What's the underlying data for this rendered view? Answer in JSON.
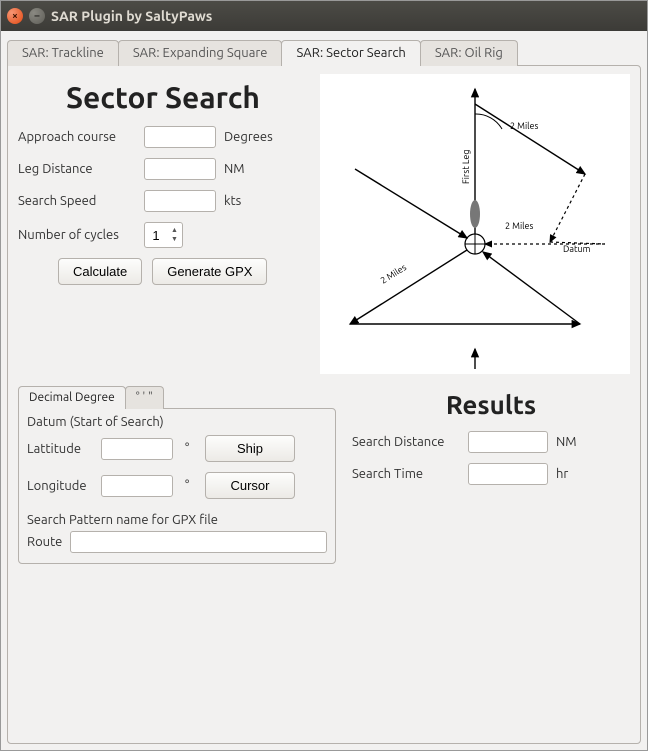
{
  "window_title": "SAR Plugin by SaltyPaws",
  "tabs": [
    {
      "label": "SAR: Trackline",
      "active": false
    },
    {
      "label": "SAR: Expanding Square",
      "active": false
    },
    {
      "label": "SAR: Sector Search",
      "active": true
    },
    {
      "label": "SAR: Oil Rig",
      "active": false
    }
  ],
  "sector": {
    "heading": "Sector Search",
    "approach_label": "Approach course",
    "approach_value": "",
    "approach_unit": "Degrees",
    "leg_label": "Leg Distance",
    "leg_value": "",
    "leg_unit": "NM",
    "speed_label": "Search Speed",
    "speed_value": "",
    "speed_unit": "kts",
    "cycles_label": "Number of cycles",
    "cycles_value": "1",
    "calculate_btn": "Calculate",
    "generate_btn": "Generate GPX"
  },
  "diagram": {
    "first_leg": "First Leg",
    "two_miles": "2 Miles",
    "datum": "Datum"
  },
  "datum_tabs": [
    {
      "label": "Decimal Degree",
      "active": true
    },
    {
      "label": "° ' \"",
      "active": false
    }
  ],
  "datum": {
    "section_title": "Datum (Start of Search)",
    "lat_label": "Lattitude",
    "lat_value": "",
    "deg_symbol": "°",
    "lon_label": "Longitude",
    "lon_value": "",
    "ship_btn": "Ship",
    "cursor_btn": "Cursor",
    "gpx_label": "Search Pattern name for GPX file",
    "route_label": "Route",
    "route_value": ""
  },
  "results": {
    "heading": "Results",
    "distance_label": "Search Distance",
    "distance_value": "",
    "distance_unit": "NM",
    "time_label": "Search Time",
    "time_value": "",
    "time_unit": "hr"
  }
}
